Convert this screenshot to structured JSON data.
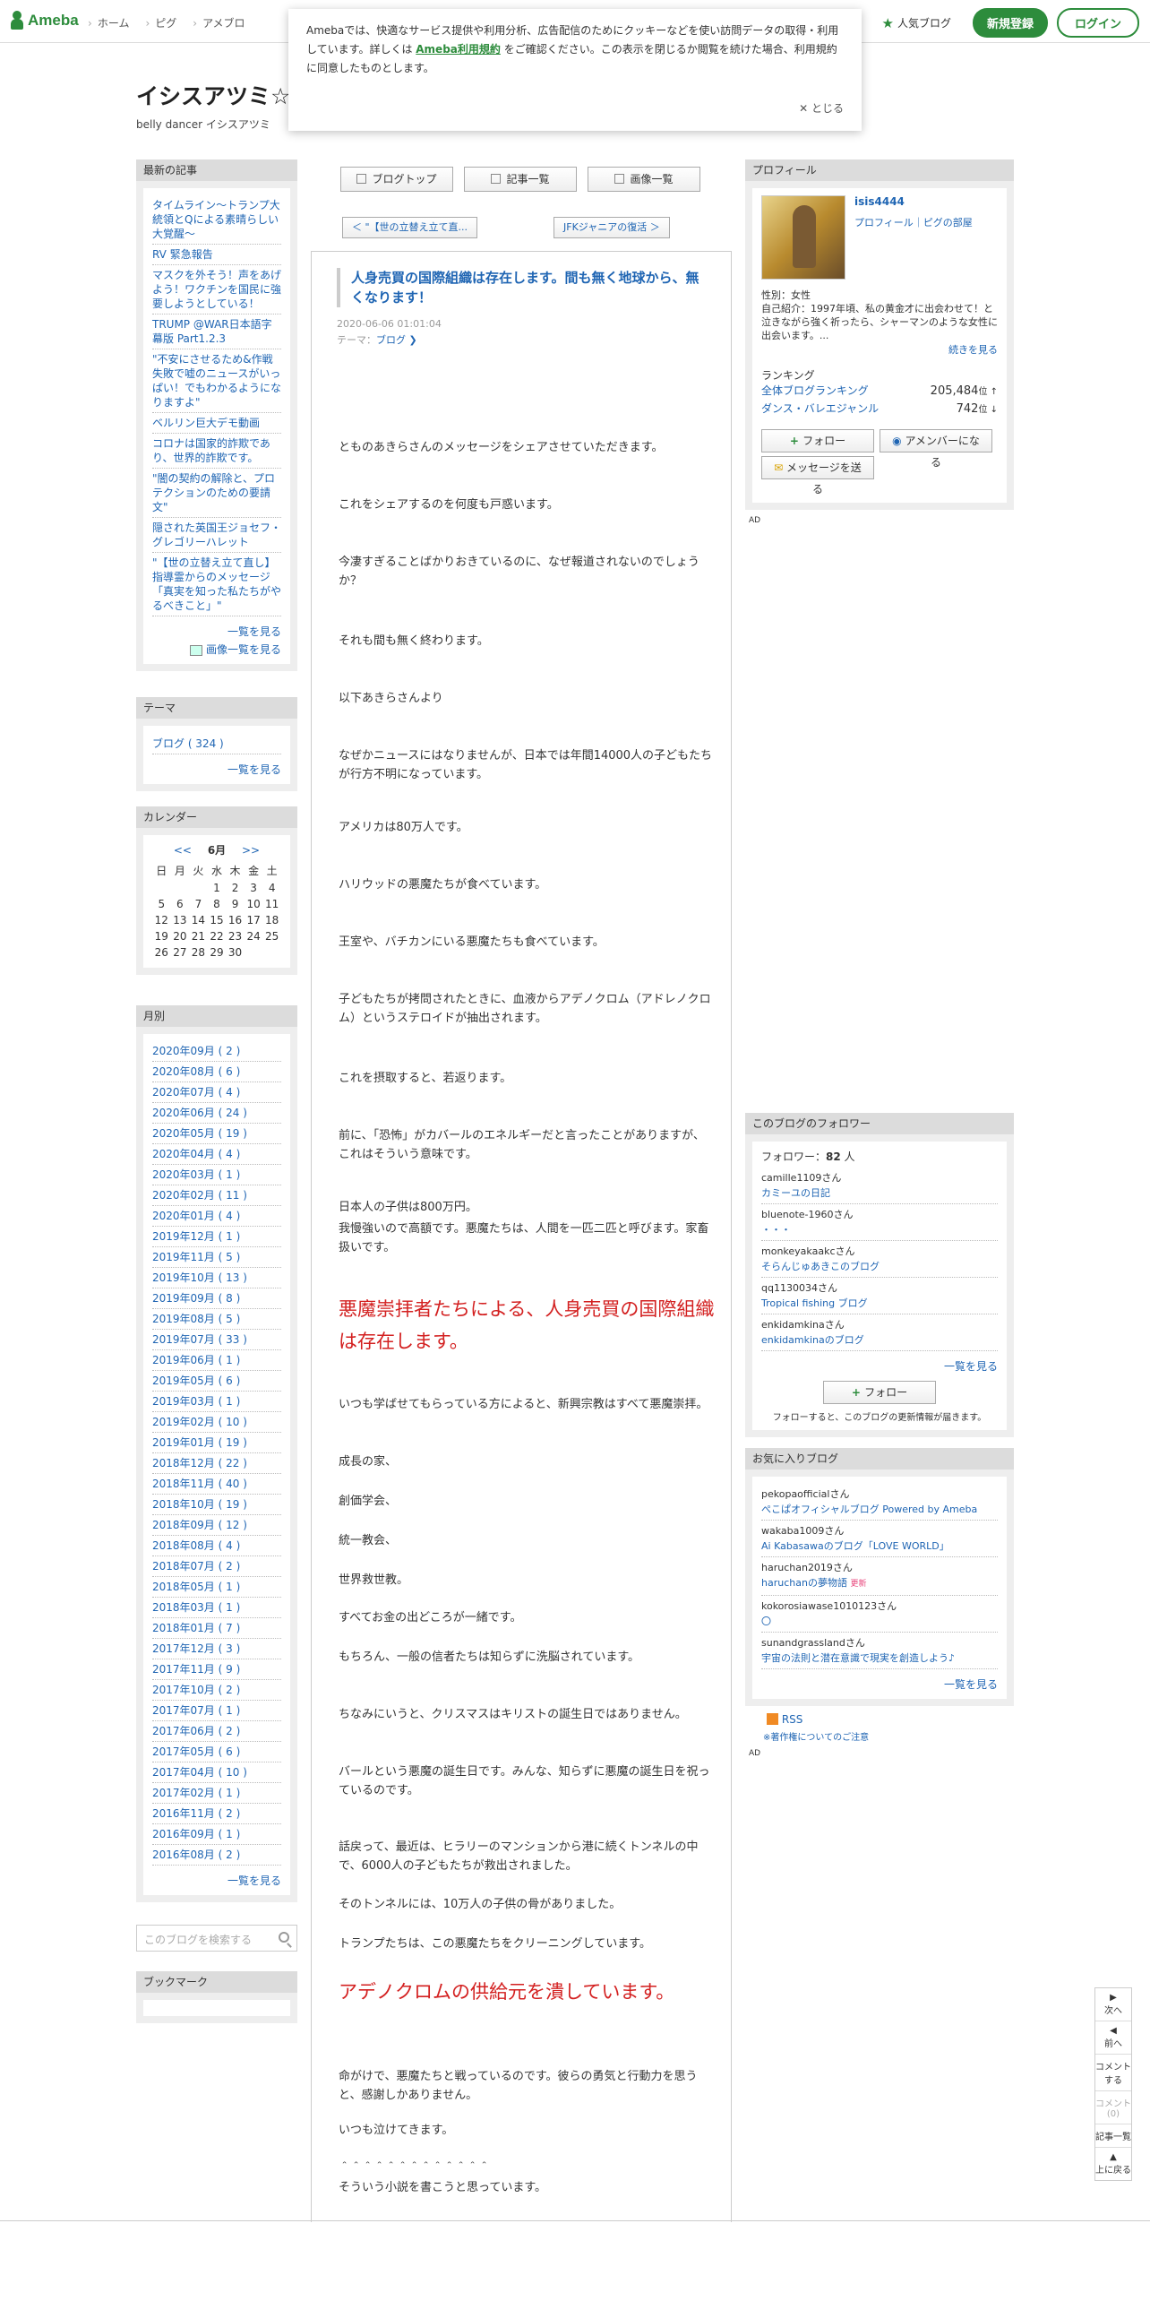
{
  "header": {
    "logo": "Ameba",
    "nav": [
      "ホーム",
      "ピグ",
      "アメブロ"
    ],
    "popular": "人気ブログ",
    "register": "新規登録",
    "login": "ログイン"
  },
  "cookie": {
    "text_before": "Amebaでは、快適なサービス提供や利用分析、広告配信のためにクッキーなどを使い訪問データの取得・利用しています。詳しくは ",
    "terms": "Ameba利用規約",
    "text_after": " をご確認ください。この表示を閉じるか閲覧を続けた場合、利用規約に同意したものとします。",
    "close": "✕ とじる"
  },
  "blog": {
    "title": "イシスアツミ☆",
    "description": "belly dancer イシスアツミ"
  },
  "recent": {
    "heading": "最新の記事",
    "items": [
      "タイムライン〜トランプ大統領とQによる素晴らしい大覚醒〜",
      "RV 緊急報告",
      "マスクを外そう！声をあげよう！ワクチンを国民に強要しようとしている！",
      "TRUMP @WAR日本語字幕版 Part1.2.3",
      "\"不安にさせるため&作戦失敗で嘘のニュースがいっぱい！でもわかるようになりますよ\"",
      "ベルリン巨大デモ動画",
      "コロナは国家的詐欺であり、世界的詐欺です。",
      "\"闇の契約の解除と、プロテクションのための要請文\"",
      "隠された英国王ジョセフ・グレゴリーハレット",
      "\"【世の立替え立て直し】指導霊からのメッセージ「真実を知った私たちがやるべきこと」\""
    ],
    "more": "一覧を見る",
    "more_images": "画像一覧を見る"
  },
  "theme": {
    "heading": "テーマ",
    "items": [
      "ブログ ( 324 )"
    ],
    "more": "一覧を見る"
  },
  "calendar": {
    "heading": "カレンダー",
    "prev": "<<",
    "month": "6月",
    "next": ">>",
    "weekdays": [
      "日",
      "月",
      "火",
      "水",
      "木",
      "金",
      "土"
    ],
    "weeks": [
      [
        "",
        "",
        "",
        "1",
        "2",
        "3",
        "4"
      ],
      [
        "5",
        "6",
        "7",
        "8",
        "9",
        "10",
        "11"
      ],
      [
        "12",
        "13",
        "14",
        "15",
        "16",
        "17",
        "18"
      ],
      [
        "19",
        "20",
        "21",
        "22",
        "23",
        "24",
        "25"
      ],
      [
        "26",
        "27",
        "28",
        "29",
        "30",
        "",
        ""
      ]
    ]
  },
  "archive": {
    "heading": "月別",
    "items": [
      "2020年09月 ( 2 )",
      "2020年08月 ( 6 )",
      "2020年07月 ( 4 )",
      "2020年06月 ( 24 )",
      "2020年05月 ( 19 )",
      "2020年04月 ( 4 )",
      "2020年03月 ( 1 )",
      "2020年02月 ( 11 )",
      "2020年01月 ( 4 )",
      "2019年12月 ( 1 )",
      "2019年11月 ( 5 )",
      "2019年10月 ( 13 )",
      "2019年09月 ( 8 )",
      "2019年08月 ( 5 )",
      "2019年07月 ( 33 )",
      "2019年06月 ( 1 )",
      "2019年05月 ( 6 )",
      "2019年03月 ( 1 )",
      "2019年02月 ( 10 )",
      "2019年01月 ( 19 )",
      "2018年12月 ( 22 )",
      "2018年11月 ( 40 )",
      "2018年10月 ( 19 )",
      "2018年09月 ( 12 )",
      "2018年08月 ( 4 )",
      "2018年07月 ( 2 )",
      "2018年05月 ( 1 )",
      "2018年03月 ( 1 )",
      "2018年01月 ( 7 )",
      "2017年12月 ( 3 )",
      "2017年11月 ( 9 )",
      "2017年10月 ( 2 )",
      "2017年07月 ( 1 )",
      "2017年06月 ( 2 )",
      "2017年05月 ( 6 )",
      "2017年04月 ( 10 )",
      "2017年02月 ( 1 )",
      "2016年11月 ( 2 )",
      "2016年09月 ( 1 )",
      "2016年08月 ( 2 )"
    ],
    "more": "一覧を見る"
  },
  "search": {
    "placeholder": "このブログを検索する"
  },
  "bookmark": {
    "heading": "ブックマーク"
  },
  "main_nav": {
    "top": "ブログトップ",
    "entries": "記事一覧",
    "images": "画像一覧",
    "prev_entry": "＜ \"【世の立替え立て直...",
    "next_entry": "JFKジャニアの復活 ＞"
  },
  "article": {
    "title": "人身売買の国際組織は存在します。間も無く地球から、無くなります！",
    "date": "2020-06-06 01:01:04",
    "theme_label": "テーマ：",
    "theme": "ブログ ❯",
    "paragraphs": [
      "とものあきらさんのメッセージをシェアさせていただきます。",
      "これをシェアするのを何度も戸惑います。",
      "今凄すぎることばかりおきているのに、なぜ報道されないのでしょうか？",
      "それも間も無く終わります。",
      "以下あきらさんより",
      "なぜかニュースにはなりませんが、日本では年間14000人の子どもたちが行方不明になっています。",
      "アメリカは80万人です。",
      "ハリウッドの悪魔たちが食べています。",
      "王室や、バチカンにいる悪魔たちも食べています。",
      "子どもたちが拷問されたときに、血液からアデノクロム（アドレノクロム）というステロイドが抽出されます。",
      "これを摂取すると、若返ります。",
      "前に、「恐怖」がカバールのエネルギーだと言ったことがありますが、これはそういう意味です。",
      "日本人の子供は800万円。",
      "我慢強いので高額です。悪魔たちは、人間を一匹二匹と呼びます。家畜扱いです。",
      "悪魔崇拝者たちによる、人身売買の国際組織は存在します。",
      "いつも学ばせてもらっている方によると、新興宗教はすべて悪魔崇拝。",
      "成長の家、",
      "創価学会、",
      "統一教会、",
      "世界救世教。",
      "すべてお金の出どころが一緒です。",
      "もちろん、一般の信者たちは知らずに洗脳されています。",
      "ちなみにいうと、クリスマスはキリストの誕生日ではありません。",
      "バールという悪魔の誕生日です。みんな、知らずに悪魔の誕生日を祝っているのです。",
      "話戻って、最近は、ヒラリーのマンションから港に続くトンネルの中で、6000人の子どもたちが救出されました。",
      "そのトンネルには、10万人の子供の骨がありました。",
      "トランプたちは、この悪魔たちをクリーニングしています。",
      "アデノクロムの供給元を潰しています。",
      "命がけで、悪魔たちと戦っているのです。彼らの勇気と行動力を思うと、感謝しかありません。",
      "いつも泣けてきます。",
      "＾＾＾＾＾＾＾＾＾＾＾＾＾",
      "そういう小説を書こうと思っています。"
    ]
  },
  "profile": {
    "heading": "プロフィール",
    "name": "isis4444",
    "links": "プロフィール｜ピグの部屋",
    "gender": "性別：女性",
    "intro": "自己紹介：1997年頃、私の黄金才に出会わせて！と泣きながら強く祈ったら、シャーマンのような女性に出会います。...",
    "read_more": "続きを見る",
    "ranking_label": "ランキング",
    "ranks": [
      {
        "name": "全体ブログランキング",
        "value": "205,484",
        "unit": "位 ↑"
      },
      {
        "name": "ダンス・バレエジャンル",
        "value": "742",
        "unit": "位 ↓"
      }
    ],
    "follow": "フォロー",
    "member": "アメンバーになる",
    "message": "メッセージを送る"
  },
  "followers": {
    "heading": "このブログのフォロワー",
    "count_label": "フォロワー：",
    "count": "82",
    "count_unit": " 人",
    "items": [
      {
        "user": "camille1109さん",
        "blog": "カミーユの日記"
      },
      {
        "user": "bluenote-1960さん",
        "blog": "・・・"
      },
      {
        "user": "monkeyakaakcさん",
        "blog": "そらんじゅあきこのブログ"
      },
      {
        "user": "qq1130034さん",
        "blog": "Tropical fishing ブログ"
      },
      {
        "user": "enkidamkinaさん",
        "blog": "enkidamkinaのブログ"
      }
    ],
    "more": "一覧を見る",
    "follow": "フォロー",
    "note": "フォローすると、このブログの更新情報が届きます。"
  },
  "favorites": {
    "heading": "お気に入りブログ",
    "items": [
      {
        "user": "pekopaofficialさん",
        "blog": "ぺこぱオフィシャルブログ Powered by Ameba"
      },
      {
        "user": "wakaba1009さん",
        "blog": "Ai Kabasawaのブログ「LOVE WORLD」"
      },
      {
        "user": "haruchan2019さん",
        "blog": "haruchanの夢物語",
        "badge": "更新"
      },
      {
        "user": "kokorosiawase1010123さん",
        "blog": "〇"
      },
      {
        "user": "sunandgrasslandさん",
        "blog": "宇宙の法則と潜在意識で現実を創造しよう♪"
      }
    ],
    "more": "一覧を見る"
  },
  "rss": {
    "label": "RSS",
    "note": "※著作権についてのご注意"
  },
  "ad_label": "AD",
  "float_nav": {
    "next": "次へ",
    "prev": "前へ",
    "comment": "コメントする",
    "comment_count": "コメント(0)",
    "entries": "記事一覧",
    "top": "上に戻る"
  },
  "colors": {
    "brand": "#2d8c3c",
    "link": "#1f65b3",
    "alert_red": "#d32020"
  }
}
